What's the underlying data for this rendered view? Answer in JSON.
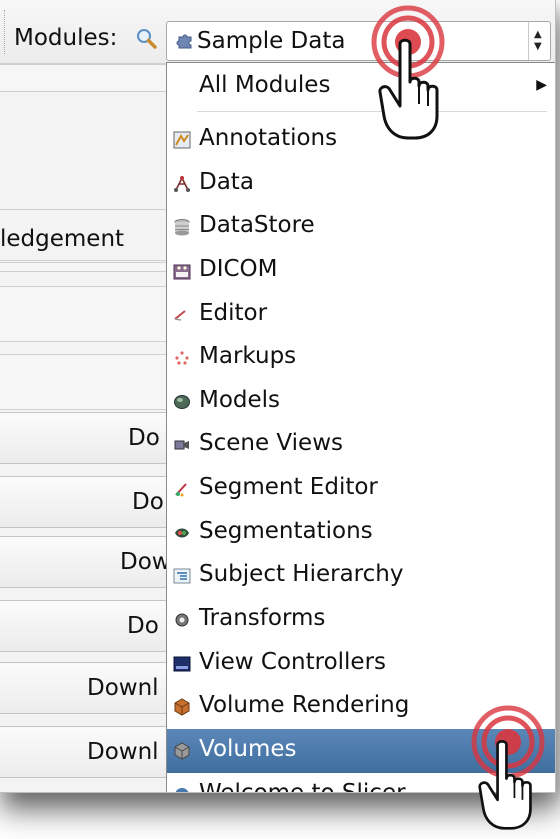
{
  "toolbar": {
    "modules_label": "Modules:",
    "selected_module": "Sample Data"
  },
  "background_panel": {
    "acknowledgement_fragment": "ledgement",
    "download_buttons": [
      "Do",
      "Do",
      "Dow",
      "Do",
      "Downl",
      "Downl"
    ]
  },
  "dropdown": {
    "all_modules": "All Modules",
    "items": [
      {
        "label": "Annotations",
        "icon": "annotations-icon"
      },
      {
        "label": "Data",
        "icon": "data-icon"
      },
      {
        "label": "DataStore",
        "icon": "datastore-icon"
      },
      {
        "label": "DICOM",
        "icon": "dicom-icon"
      },
      {
        "label": "Editor",
        "icon": "editor-icon"
      },
      {
        "label": "Markups",
        "icon": "markups-icon"
      },
      {
        "label": "Models",
        "icon": "models-icon"
      },
      {
        "label": "Scene Views",
        "icon": "scene-views-icon"
      },
      {
        "label": "Segment Editor",
        "icon": "segment-editor-icon"
      },
      {
        "label": "Segmentations",
        "icon": "segmentations-icon"
      },
      {
        "label": "Subject Hierarchy",
        "icon": "subject-hierarchy-icon"
      },
      {
        "label": "Transforms",
        "icon": "transforms-icon"
      },
      {
        "label": "View Controllers",
        "icon": "view-controllers-icon"
      },
      {
        "label": "Volume Rendering",
        "icon": "volume-rendering-icon"
      },
      {
        "label": "Volumes",
        "icon": "volumes-icon"
      },
      {
        "label": "Welcome to Slicer",
        "icon": "welcome-icon"
      }
    ],
    "highlighted_item": "Volumes"
  },
  "colors": {
    "selection": "#4a78aa",
    "ripple": "#d9363e"
  }
}
